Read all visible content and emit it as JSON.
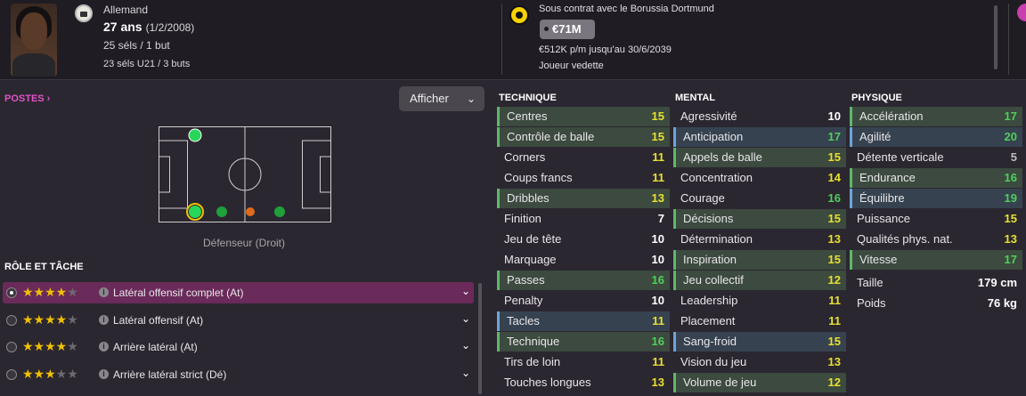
{
  "header": {
    "nationality": "Allemand",
    "age": "27 ans",
    "dob": "(1/2/2008)",
    "caps": "25 séls / 1 but",
    "u21": "23 séls U21 / 3 buts",
    "contract": "Sous contrat avec le Borussia Dortmund",
    "value": "€71M",
    "wage": "€512K p/m jusqu'au 30/6/2039",
    "status": "Joueur vedette"
  },
  "left": {
    "postes_label": "POSTES ›",
    "afficher_label": "Afficher",
    "afficher_chevron": "⌄",
    "position_label": "Défenseur (Droit)",
    "roles_title": "RÔLE ET TÂCHE",
    "roles": [
      {
        "name": "Latéral offensif complet (At)",
        "stars_on": "★★★★",
        "stars_off": "★",
        "stars": 4
      },
      {
        "name": "Latéral offensif (At)",
        "stars_on": "★★★★",
        "stars_off": "★",
        "stars": 4
      },
      {
        "name": "Arrière latéral (At)",
        "stars_on": "★★★★",
        "stars_off": "★",
        "stars": 4
      },
      {
        "name": "Arrière latéral strict (Dé)",
        "stars_on": "★★★",
        "stars_off": "★★",
        "stars": 3
      }
    ]
  },
  "technique": {
    "title": "TECHNIQUE",
    "items": [
      {
        "name": "Centres",
        "value": "15"
      },
      {
        "name": "Contrôle de balle",
        "value": "15"
      },
      {
        "name": "Corners",
        "value": "11"
      },
      {
        "name": "Coups francs",
        "value": "11"
      },
      {
        "name": "Dribbles",
        "value": "13"
      },
      {
        "name": "Finition",
        "value": "7"
      },
      {
        "name": "Jeu de tête",
        "value": "10"
      },
      {
        "name": "Marquage",
        "value": "10"
      },
      {
        "name": "Passes",
        "value": "16"
      },
      {
        "name": "Penalty",
        "value": "10"
      },
      {
        "name": "Tacles",
        "value": "11"
      },
      {
        "name": "Technique",
        "value": "16"
      },
      {
        "name": "Tirs de loin",
        "value": "11"
      },
      {
        "name": "Touches longues",
        "value": "13"
      }
    ]
  },
  "mental": {
    "title": "MENTAL",
    "items": [
      {
        "name": "Agressivité",
        "value": "10"
      },
      {
        "name": "Anticipation",
        "value": "17"
      },
      {
        "name": "Appels de balle",
        "value": "15"
      },
      {
        "name": "Concentration",
        "value": "14"
      },
      {
        "name": "Courage",
        "value": "16"
      },
      {
        "name": "Décisions",
        "value": "15"
      },
      {
        "name": "Détermination",
        "value": "13"
      },
      {
        "name": "Inspiration",
        "value": "15"
      },
      {
        "name": "Jeu collectif",
        "value": "12"
      },
      {
        "name": "Leadership",
        "value": "11"
      },
      {
        "name": "Placement",
        "value": "11"
      },
      {
        "name": "Sang-froid",
        "value": "15"
      },
      {
        "name": "Vision du jeu",
        "value": "13"
      },
      {
        "name": "Volume de jeu",
        "value": "12"
      }
    ]
  },
  "physique": {
    "title": "PHYSIQUE",
    "items": [
      {
        "name": "Accélération",
        "value": "17"
      },
      {
        "name": "Agilité",
        "value": "20"
      },
      {
        "name": "Détente verticale",
        "value": "5"
      },
      {
        "name": "Endurance",
        "value": "16"
      },
      {
        "name": "Équilibre",
        "value": "19"
      },
      {
        "name": "Puissance",
        "value": "15"
      },
      {
        "name": "Qualités phys. nat.",
        "value": "13"
      },
      {
        "name": "Vitesse",
        "value": "17"
      }
    ],
    "height_label": "Taille",
    "height_value": "179 cm",
    "weight_label": "Poids",
    "weight_value": "76 kg"
  },
  "colors": {
    "accent": "#e052c6",
    "good": "#4fd05a",
    "mid": "#e8e030",
    "white": "#ffffff"
  }
}
